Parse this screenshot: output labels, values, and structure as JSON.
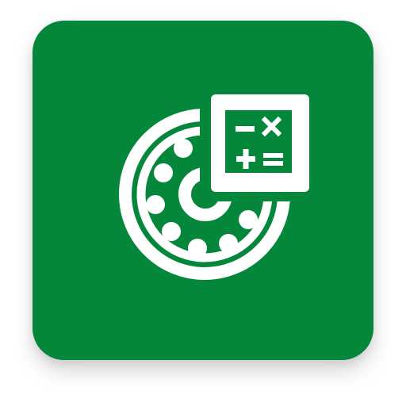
{
  "app_icon": {
    "icon_name": "bearing-calculator-icon",
    "colors": {
      "background": "#04873B",
      "glyph": "#FFFFFF",
      "page": "#FFFFFF"
    },
    "calculator_keys": [
      "−",
      "×",
      "+",
      "="
    ]
  }
}
